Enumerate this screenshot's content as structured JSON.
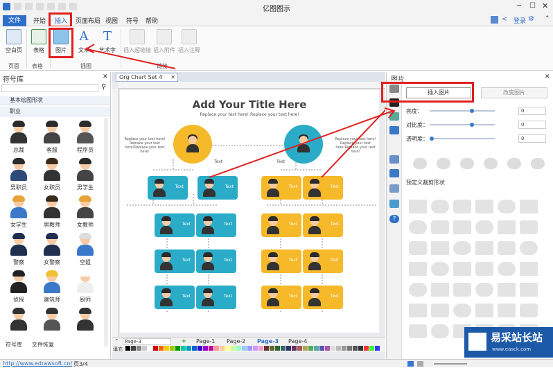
{
  "app_title": "亿图图示",
  "menu": {
    "file": "文件",
    "items": [
      "开始",
      "插入",
      "页面布局",
      "视图",
      "符号",
      "帮助"
    ]
  },
  "user": {
    "login": "登录"
  },
  "ribbon": {
    "buttons": [
      {
        "label": "空白页",
        "icon": "blank-page-icon"
      },
      {
        "label": "表格",
        "icon": "table-icon"
      },
      {
        "label": "图片",
        "icon": "image-icon"
      },
      {
        "label": "文本",
        "icon": "text-icon"
      },
      {
        "label": "艺术字",
        "icon": "wordart-icon"
      },
      {
        "label": "插入超链接",
        "icon": "hyperlink-icon"
      },
      {
        "label": "插入附件",
        "icon": "attachment-icon"
      },
      {
        "label": "插入注释",
        "icon": "comment-icon"
      }
    ],
    "groups": [
      "页面",
      "表格",
      "插图",
      "链接"
    ]
  },
  "symbol_library": {
    "title": "符号库",
    "categories": [
      "基本绘图形状",
      "职业"
    ],
    "items": [
      "总裁",
      "客服",
      "程序员",
      "男职员",
      "女职员",
      "男学生",
      "女学生",
      "男教师",
      "女教师",
      "警察",
      "女警察",
      "空姐",
      "侦探",
      "建筑师",
      "厨师",
      "",
      "",
      ""
    ],
    "bottom_tabs": [
      "符号库",
      "文件恢复"
    ]
  },
  "document": {
    "tab_title": "Org Chart Set 4",
    "title": "Add Your Title Here",
    "subtitle": "Replace your text here!   Replace your text here!",
    "left_note": "Replace your text here! Replace your text here!Replace your text here!",
    "right_note": "Replace your text here! Replace your text here!Replace your text here!",
    "card_text": "Text",
    "root_label": "Text"
  },
  "pages": {
    "current": "Page-3",
    "tabs": [
      "Page-1",
      "Page-2",
      "Page-3",
      "Page-4"
    ],
    "fill_label": "填充"
  },
  "image_panel": {
    "title": "图片",
    "insert_button": "插入图片",
    "change_button": "改变图片",
    "brightness_label": "亮度：",
    "contrast_label": "对比度：",
    "transparency_label": "透明度：",
    "brightness_value": "0",
    "contrast_value": "0",
    "transparency_value": "0",
    "crop_shape_label": "预定义裁剪形状"
  },
  "status": {
    "url": "http://www.edrawsoft.cn/",
    "page": "页3/4"
  },
  "watermark": {
    "brand": "易采站长站",
    "url": "www.easck.com"
  },
  "colors": {
    "accent_blue": "#2e70c9",
    "teal": "#2aacc8",
    "orange": "#f5b92a",
    "highlight_red": "#e02020"
  }
}
